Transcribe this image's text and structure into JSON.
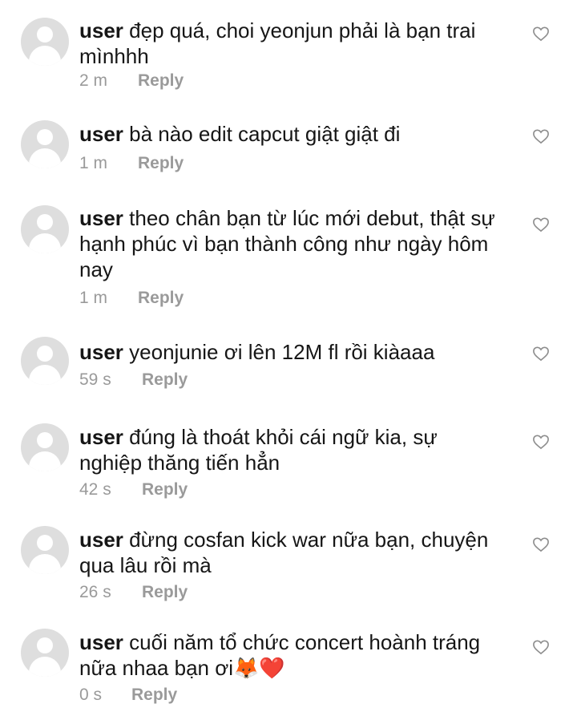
{
  "comments": [
    {
      "user": "user",
      "text": "đẹp quá, choi yeonjun phải là bạn trai mìnhhh",
      "time": "2 m",
      "reply": "Reply"
    },
    {
      "user": "user",
      "text": "bà nào edit capcut giật giật đi",
      "time": "1 m",
      "reply": "Reply"
    },
    {
      "user": "user",
      "text": "theo chân bạn từ lúc mới debut, thật sự hạnh phúc vì bạn thành công như ngày hôm nay",
      "time": "1 m",
      "reply": "Reply"
    },
    {
      "user": "user",
      "text": "yeonjunie ơi lên 12M fl rồi kiàaaa",
      "time": "59 s",
      "reply": "Reply"
    },
    {
      "user": "user",
      "text": "đúng là thoát khỏi cái ngữ kia, sự nghiệp thăng tiến hẳn",
      "time": "42 s",
      "reply": "Reply"
    },
    {
      "user": "user",
      "text": "đừng cosfan kick war nữa bạn, chuyện qua lâu rồi mà",
      "time": "26 s",
      "reply": "Reply"
    },
    {
      "user": "user",
      "text": "cuối năm tổ chức concert hoành tráng nữa nhaa bạn ơi🦊❤️",
      "time": "0 s",
      "reply": "Reply"
    }
  ],
  "icons": {
    "avatar": "default-user-avatar",
    "like": "heart-outline-icon"
  },
  "colors": {
    "text": "#161616",
    "meta": "#9a9a9a",
    "avatar_bg": "#dedede"
  }
}
